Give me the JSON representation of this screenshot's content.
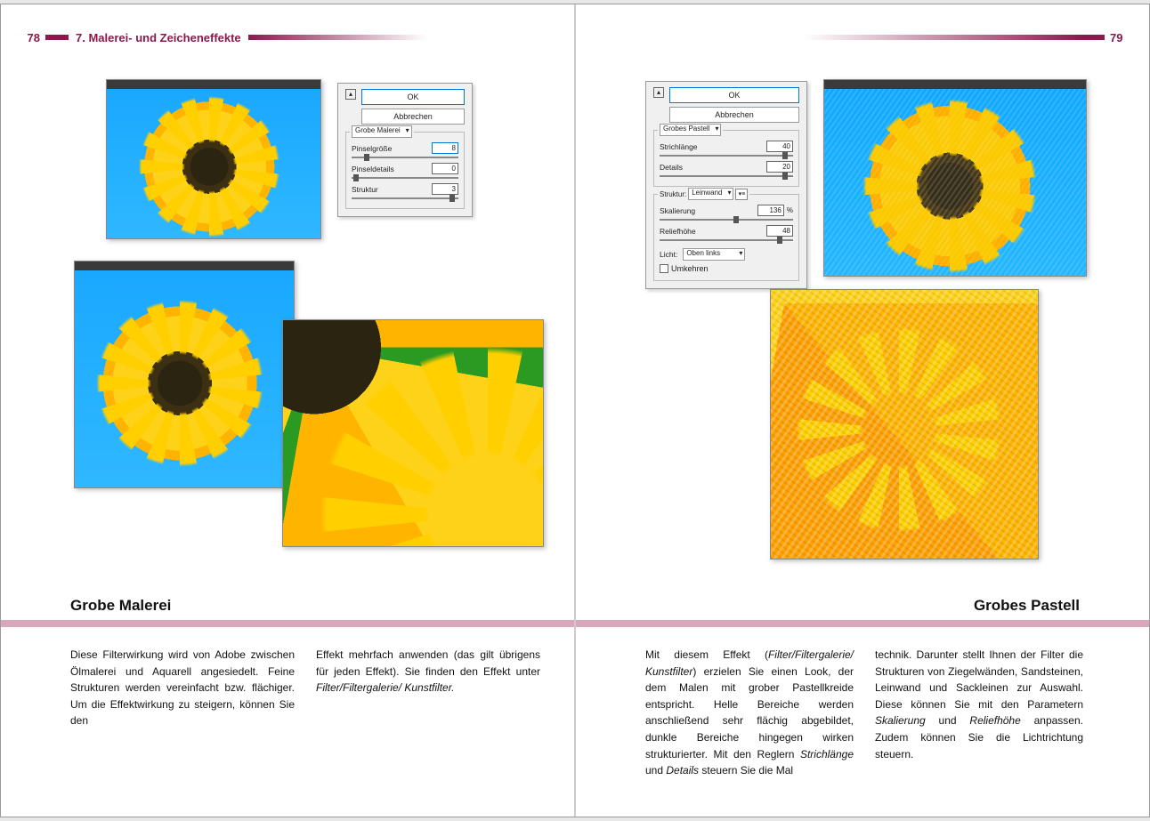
{
  "header": {
    "page_left": "78",
    "page_right": "79",
    "chapter": "7. Malerei- und Zeicheneffekte"
  },
  "left_page": {
    "dialog": {
      "ok": "OK",
      "cancel": "Abbrechen",
      "filter_name": "Grobe Malerei",
      "params": {
        "pinselgroesse": {
          "label": "Pinselgröße",
          "value": "8"
        },
        "pinseldetails": {
          "label": "Pinseldetails",
          "value": "0"
        },
        "struktur": {
          "label": "Struktur",
          "value": "3"
        }
      }
    },
    "section_title": "Grobe Malerei",
    "body": {
      "col1": "Diese Filterwirkung wird von Adobe zwischen Ölmalerei und Aquarell ange­siedelt. Feine Strukturen werden ver­einfacht bzw. flächiger. Um die Effekt­wirkung zu steigern, können Sie den",
      "col2_a": "Effekt mehrfach anwenden (das gilt übrigens für jeden Effekt). Sie finden den Effekt unter ",
      "col2_b": "Filter/Filtergalerie/ Kunstfilter."
    }
  },
  "right_page": {
    "dialog": {
      "ok": "OK",
      "cancel": "Abbrechen",
      "filter_name": "Grobes Pastell",
      "params": {
        "strichlaenge": {
          "label": "Strichlänge",
          "value": "40"
        },
        "details": {
          "label": "Details",
          "value": "20"
        }
      },
      "texture": {
        "legend": "Struktur:",
        "texture_name": "Leinwand",
        "skalierung": {
          "label": "Skalierung",
          "value": "136",
          "unit": "%"
        },
        "reliefhoehe": {
          "label": "Reliefhöhe",
          "value": "48"
        },
        "licht_label": "Licht:",
        "licht_value": "Oben links",
        "umkehren": "Umkehren"
      }
    },
    "section_title": "Grobes Pastell",
    "body": {
      "col1_a": "Mit diesem Effekt (",
      "col1_b": "Filter/Filtergalerie/ Kunstfilter",
      "col1_c": ") erzielen Sie einen Look, der dem Malen mit grober Pastellkreide entspricht. Helle Bereiche werden anschließend sehr flächig abgebildet, dunkle Bereiche hingegen wirken strukturierter. Mit den Reglern ",
      "col1_d": "Strich­länge",
      "col1_e": " und ",
      "col1_f": "Details",
      "col1_g": " steuern Sie die Mal­",
      "col2_a": "technik. Darunter stellt Ihnen der Filter die Strukturen von Ziegelwänden, Sandsteinen, Leinwand und Sacklei­nen zur Auswahl. Diese können Sie mit den Parametern ",
      "col2_b": "Skalierung",
      "col2_c": " und ",
      "col2_d": "Relief­höhe",
      "col2_e": " anpassen. Zudem können Sie die Lichtrichtung steuern."
    }
  }
}
